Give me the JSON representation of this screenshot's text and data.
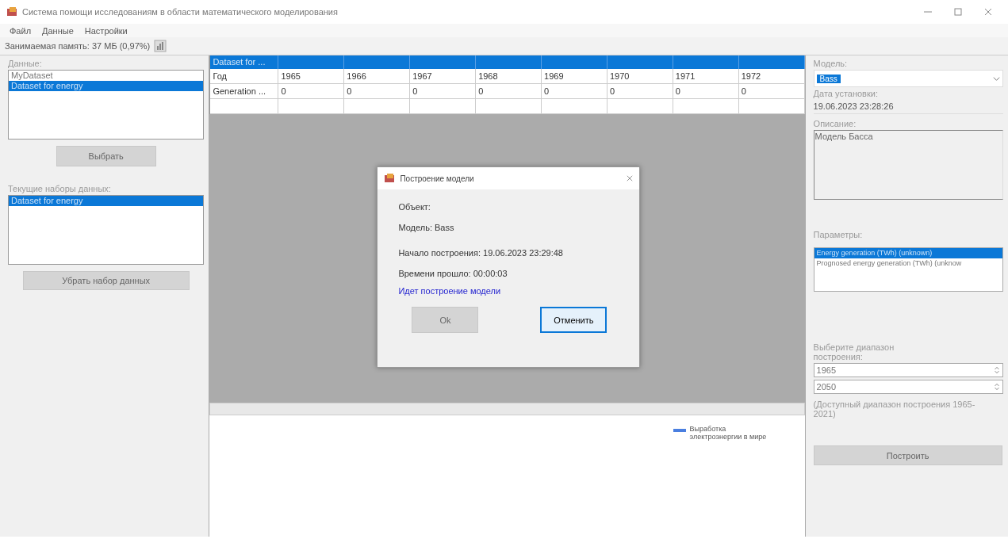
{
  "window": {
    "title": "Система помощи исследованиям в области математического моделирования"
  },
  "menu": [
    {
      "label": "Файл"
    },
    {
      "label": "Данные"
    },
    {
      "label": "Настройки"
    }
  ],
  "memory": {
    "label": "Занимаемая память: 37 МБ (0,97%)"
  },
  "left": {
    "data_label": "Данные:",
    "data_list": [
      {
        "label": "MyDataset",
        "selected": false
      },
      {
        "label": "Dataset for energy",
        "selected": true
      }
    ],
    "select_button": {
      "label": "Выбрать",
      "disabled": true
    },
    "current_label": "Текущие наборы данных:",
    "current_list": [
      {
        "label": "Dataset for energy",
        "selected": true
      }
    ],
    "remove_button": {
      "label": "Убрать набор данных",
      "disabled": true
    }
  },
  "table": {
    "header": "Dataset for ...",
    "rows": [
      {
        "cells": [
          "Год",
          "1965",
          "1966",
          "1967",
          "1968",
          "1969",
          "1970",
          "1971",
          "1972"
        ]
      },
      {
        "cells": [
          "Generation ...",
          "0",
          "0",
          "0",
          "0",
          "0",
          "0",
          "0",
          "0"
        ]
      }
    ]
  },
  "chart": {
    "legend": [
      {
        "label": "Выработка электроэнергии в мире",
        "color": "#4a7fe0"
      }
    ]
  },
  "right": {
    "model_label": "Модель:",
    "model_value": "Bass",
    "date_label": "Дата установки:",
    "date_value": "19.06.2023 23:28:26",
    "desc_label": "Описание:",
    "desc_value": "Модель Басса",
    "params_label": "Параметры:",
    "params": [
      {
        "label": "Energy generation (TWh) (unknown)",
        "selected": true
      },
      {
        "label": "Prognosed energy generation (TWh) (unknow",
        "selected": false
      }
    ],
    "range_label": "Выберите диапазон построения:",
    "range_from": "1965",
    "range_to": "2050",
    "range_hint": "(Доступный диапазон построения 1965-2021)",
    "build_button": {
      "label": "Построить",
      "disabled": true
    }
  },
  "dialog": {
    "title": "Построение модели",
    "lines": [
      {
        "kind": "text",
        "text": "Объект:"
      },
      {
        "kind": "text",
        "text": "Модель: Bass"
      },
      {
        "kind": "text",
        "text": "Начало построения: 19.06.2023 23:29:48"
      },
      {
        "kind": "text",
        "text": "Времени прошло: 00:00:03"
      },
      {
        "kind": "status",
        "text": "Идет построение модели"
      }
    ],
    "buttons": [
      {
        "label": "Ok",
        "disabled": true,
        "focused": false
      },
      {
        "label": "Отменить",
        "disabled": false,
        "focused": true
      }
    ]
  }
}
